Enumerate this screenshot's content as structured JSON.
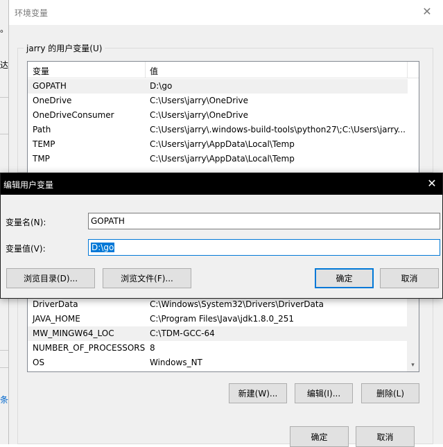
{
  "background_window": {
    "fragments": [
      "。",
      "达技",
      "条"
    ]
  },
  "env_window": {
    "title": "环境变量",
    "user_group": {
      "label": "jarry 的用户变量(U)",
      "columns": [
        "变量",
        "值"
      ],
      "rows": [
        {
          "name": "GOPATH",
          "value": "D:\\go",
          "selected": true
        },
        {
          "name": "OneDrive",
          "value": "C:\\Users\\jarry\\OneDrive"
        },
        {
          "name": "OneDriveConsumer",
          "value": "C:\\Users\\jarry\\OneDrive"
        },
        {
          "name": "Path",
          "value": "C:\\Users\\jarry\\.windows-build-tools\\python27\\;C:\\Users\\jarry..."
        },
        {
          "name": "TEMP",
          "value": "C:\\Users\\jarry\\AppData\\Local\\Temp"
        },
        {
          "name": "TMP",
          "value": "C:\\Users\\jarry\\AppData\\Local\\Temp"
        }
      ]
    },
    "system_group": {
      "rows": [
        {
          "name": "DriverData",
          "value": "C:\\Windows\\System32\\Drivers\\DriverData"
        },
        {
          "name": "JAVA_HOME",
          "value": "C:\\Program Files\\Java\\jdk1.8.0_251"
        },
        {
          "name": "MW_MINGW64_LOC",
          "value": "C:\\TDM-GCC-64",
          "selected": true
        },
        {
          "name": "NUMBER_OF_PROCESSORS",
          "value": "8"
        },
        {
          "name": "OS",
          "value": "Windows_NT"
        }
      ],
      "buttons": {
        "new": "新建(W)...",
        "edit": "编辑(I)...",
        "delete": "删除(L)"
      }
    },
    "footer": {
      "ok": "确定",
      "cancel": "取消"
    }
  },
  "edit_dialog": {
    "title": "编辑用户变量",
    "name_label": "变量名(N):",
    "name_value": "GOPATH",
    "value_label": "变量值(V):",
    "value_value": "D:\\go",
    "browse_dir": "浏览目录(D)...",
    "browse_file": "浏览文件(F)...",
    "ok": "确定",
    "cancel": "取消"
  },
  "colors": {
    "accent": "#0078d7",
    "selection_row": "#f0f0f0",
    "dialog_titlebar": "#000000"
  }
}
